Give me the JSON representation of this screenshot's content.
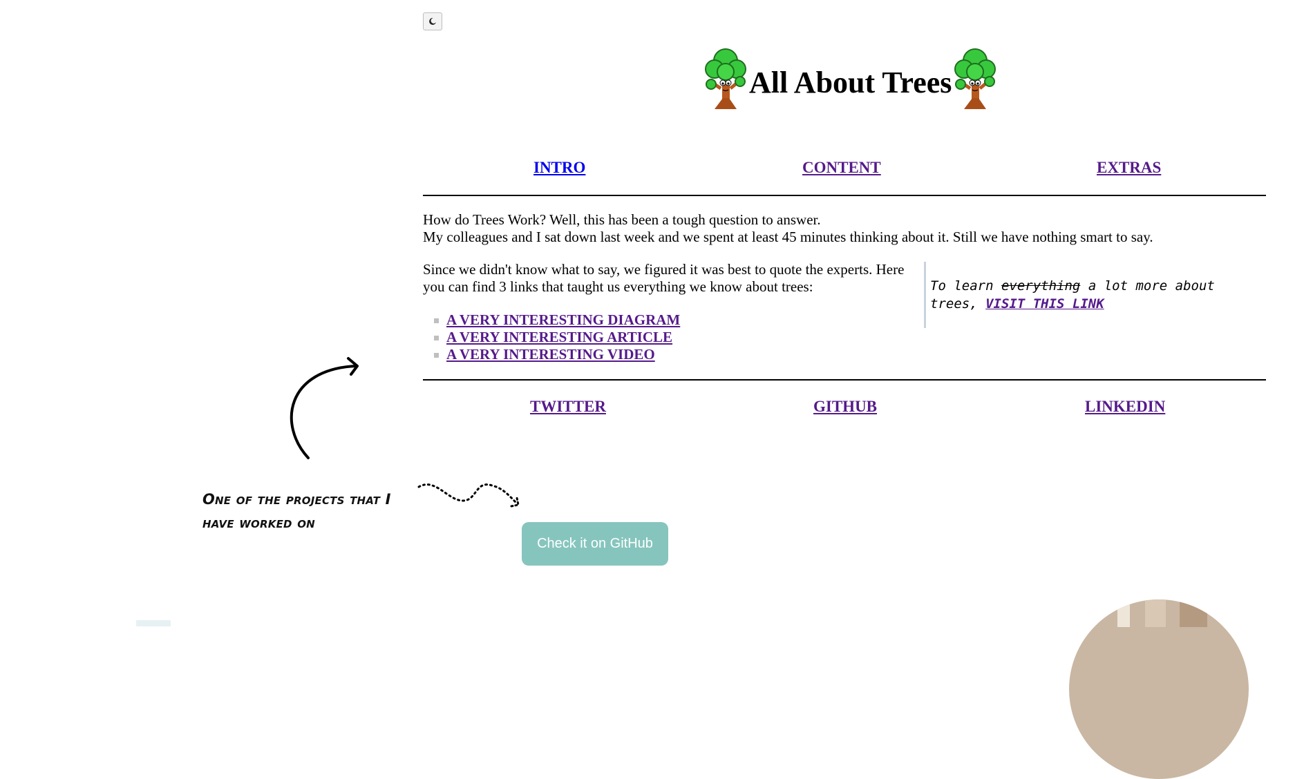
{
  "theme_toggle": {
    "icon": "moon-icon"
  },
  "header": {
    "title": "All About Trees",
    "icon": "tree-icon"
  },
  "nav": [
    {
      "label": "INTRO"
    },
    {
      "label": "CONTENT"
    },
    {
      "label": "EXTRAS"
    }
  ],
  "intro": {
    "line1": "How do Trees Work? Well, this has been a tough question to answer.",
    "line2": "My colleagues and I sat down last week and we spent at least 45 minutes thinking about it. Still we have nothing smart to say."
  },
  "experts": {
    "line1": "Since we didn't know what to say, we figured it was best to quote the experts. Here",
    "line2": "you can find 3 links that taught us everything we know about trees:",
    "links": [
      {
        "label": "A VERY INTERESTING DIAGRAM"
      },
      {
        "label": "A VERY INTERESTING ARTICLE"
      },
      {
        "label": "A VERY INTERESTING VIDEO"
      }
    ]
  },
  "aside": {
    "prefix": "To learn",
    "struck": "everything",
    "suffix": "a lot more about",
    "line2_prefix": "trees,",
    "link": "VISIT THIS LINK"
  },
  "social": [
    {
      "label": "TWITTER"
    },
    {
      "label": "GITHUB"
    },
    {
      "label": "LINKEDIN"
    }
  ],
  "portfolio": {
    "caption": "One of the projects that I have worked on",
    "button_label": "Check it on GitHub"
  },
  "colors": {
    "visited_link": "#551a8b",
    "link": "#0000ee",
    "button_bg": "#86c5bd",
    "aside_border": "#c9d3de"
  }
}
